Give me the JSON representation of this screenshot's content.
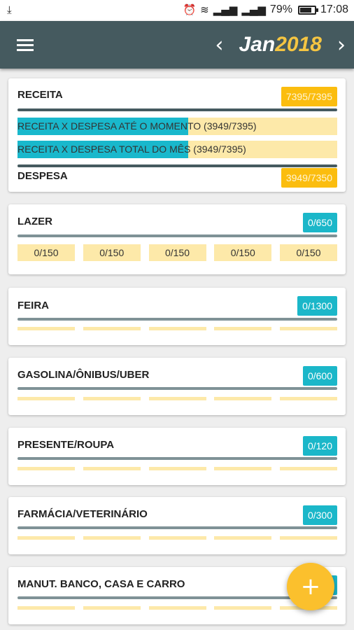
{
  "status_bar": {
    "left_icon": "download-icon",
    "alarm_icon": "alarm-icon",
    "wifi_icon": "wifi-icon",
    "signal_icon": "signal-icon",
    "battery_percent": "79%",
    "battery_level": 0.79,
    "time": "17:08"
  },
  "app_bar": {
    "menu_icon": "hamburger-menu-icon",
    "prev_icon": "chevron-left-icon",
    "next_icon": "chevron-right-icon",
    "month": "Jan",
    "year": "2018",
    "year_color": "#f5c542"
  },
  "summary": {
    "receita_label": "RECEITA",
    "receita_badge": "7395/7395",
    "progress_current": {
      "text": "RECEITA X DESPESA ATÉ O MOMENTO (3949/7395)",
      "value": 3949,
      "max": 7395
    },
    "progress_total": {
      "text": "RECEITA X DESPESA TOTAL DO MÊS (3949/7395)",
      "value": 3949,
      "max": 7395
    },
    "despesa_label": "DESPESA",
    "despesa_badge": "3949/7350"
  },
  "categories": [
    {
      "name": "LAZER",
      "badge": "0/650",
      "subs": [
        "0/150",
        "0/150",
        "0/150",
        "0/150",
        "0/150"
      ]
    },
    {
      "name": "FEIRA",
      "badge": "0/1300"
    },
    {
      "name": "GASOLINA/ÔNIBUS/UBER",
      "badge": "0/600"
    },
    {
      "name": "PRESENTE/ROUPA",
      "badge": "0/120"
    },
    {
      "name": "FARMÁCIA/VETERINÁRIO",
      "badge": "0/300"
    },
    {
      "name": "MANUT. BANCO, CASA E CARRO",
      "badge": ""
    }
  ],
  "fab": {
    "icon": "plus-icon",
    "label": "+"
  },
  "colors": {
    "app_bar": "#455a5f",
    "accent_yellow": "#fbbd0f",
    "accent_cyan": "#1bb7c9",
    "bar_pale": "#fde9a9"
  }
}
